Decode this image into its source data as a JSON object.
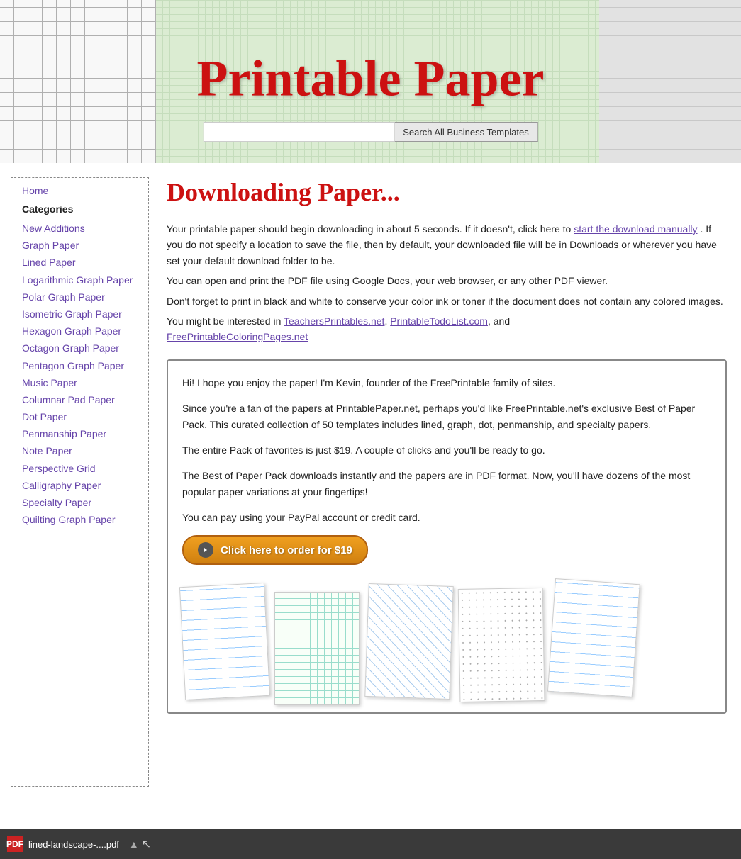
{
  "header": {
    "title": "Printable Paper",
    "search_placeholder": "",
    "search_button": "Search All Business Templates"
  },
  "sidebar": {
    "home_label": "Home",
    "categories_label": "Categories",
    "links": [
      {
        "label": "New Additions",
        "id": "new-additions"
      },
      {
        "label": "Graph Paper",
        "id": "graph-paper"
      },
      {
        "label": "Lined Paper",
        "id": "lined-paper"
      },
      {
        "label": "Logarithmic Graph Paper",
        "id": "logarithmic-graph-paper"
      },
      {
        "label": "Polar Graph Paper",
        "id": "polar-graph-paper"
      },
      {
        "label": "Isometric Graph Paper",
        "id": "isometric-graph-paper"
      },
      {
        "label": "Hexagon Graph Paper",
        "id": "hexagon-graph-paper"
      },
      {
        "label": "Octagon Graph Paper",
        "id": "octagon-graph-paper"
      },
      {
        "label": "Pentagon Graph Paper",
        "id": "pentagon-graph-paper"
      },
      {
        "label": "Music Paper",
        "id": "music-paper"
      },
      {
        "label": "Columnar Pad Paper",
        "id": "columnar-pad-paper"
      },
      {
        "label": "Dot Paper",
        "id": "dot-paper"
      },
      {
        "label": "Penmanship Paper",
        "id": "penmanship-paper"
      },
      {
        "label": "Note Paper",
        "id": "note-paper"
      },
      {
        "label": "Perspective Grid",
        "id": "perspective-grid"
      },
      {
        "label": "Calligraphy Paper",
        "id": "calligraphy-paper"
      },
      {
        "label": "Specialty Paper",
        "id": "specialty-paper"
      },
      {
        "label": "Quilting Graph Paper",
        "id": "quilting-graph-paper"
      }
    ]
  },
  "content": {
    "page_title": "Downloading Paper...",
    "para1": "Your printable paper should begin downloading in about 5 seconds. If it doesn't, click here to",
    "para1_link": "start the download manually",
    "para1_cont": ". If you do not specify a location to save the file, then by default, your downloaded file will be in Downloads or wherever you have set your default download folder to be.",
    "para2": "You can open and print the PDF file using Google Docs, your web browser, or any other PDF viewer.",
    "para3": "Don't forget to print in black and white to conserve your color ink or toner if the document does not contain any colored images.",
    "para4": "You might be interested in",
    "link1": "TeachersPrintables.net",
    "comma": ",",
    "link2": "PrintableTodoList.com",
    "and": ", and",
    "link3": "FreePrintableColoringPages.net",
    "promo": {
      "p1": "Hi! I hope you enjoy the paper! I'm Kevin, founder of the FreePrintable family of sites.",
      "p2": "Since you're a fan of the papers at PrintablePaper.net, perhaps you'd like FreePrintable.net's exclusive Best of Paper Pack. This curated collection of 50 templates includes lined, graph, dot, penmanship, and specialty papers.",
      "p3": "The entire Pack of favorites is just $19. A couple of clicks and you'll be ready to go.",
      "p4": "The Best of Paper Pack downloads instantly and the papers are in PDF format. Now, you'll have dozens of the most popular paper variations at your fingertips!",
      "p5": "You can pay using your PayPal account or credit card.",
      "button_label": "Click here to order for $19"
    }
  },
  "download_bar": {
    "filename": "lined-landscape-....pdf",
    "icon_label": "PDF"
  }
}
